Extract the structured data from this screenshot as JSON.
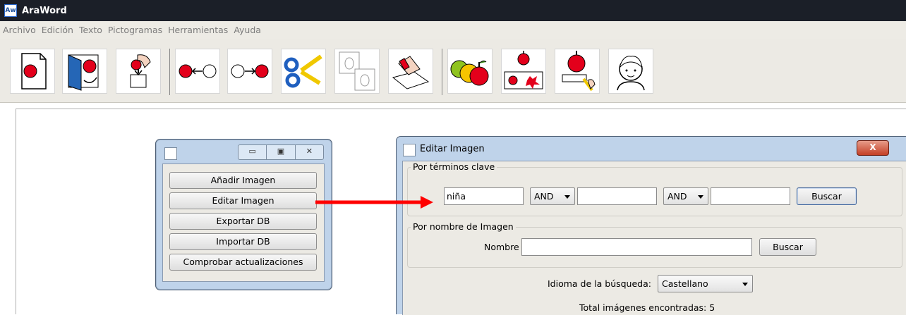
{
  "app": {
    "title": "AraWord",
    "icon_text": "Aw"
  },
  "menu": [
    "Archivo",
    "Edición",
    "Texto",
    "Pictogramas",
    "Herramientas",
    "Ayuda"
  ],
  "toolbar": {
    "icons": [
      "new-document-icon",
      "open-document-icon",
      "save-document-icon",
      "previous-icon",
      "next-icon",
      "scissors-icon",
      "copy-icon",
      "paste-icon",
      "pictogram-set-icon",
      "pictogram-variants-icon",
      "pictogram-edit-icon",
      "face-icon"
    ]
  },
  "mini_dialog": {
    "controls": [
      "▭",
      "▣",
      "✕"
    ],
    "buttons": [
      "Añadir Imagen",
      "Editar Imagen",
      "Exportar DB",
      "Importar DB",
      "Comprobar actualizaciones"
    ]
  },
  "edit_dialog": {
    "title": "Editar Imagen",
    "close_label": "X",
    "keywords_legend": "Por términos clave",
    "term1": "niña",
    "op1": "AND",
    "term2": "",
    "op2": "AND",
    "term3": "",
    "search_label": "Buscar",
    "name_legend": "Por nombre de Imagen",
    "name_label": "Nombre",
    "name_value": "",
    "name_search_label": "Buscar",
    "language_label": "Idioma de la búsqueda:",
    "language_value": "Castellano",
    "total_label": "Total imágenes encontradas: 5"
  },
  "colors": {
    "titlebar": "#1b1f28",
    "dialog_frame": "#bfd3ea",
    "arrow": "#ff0000",
    "close_button": "#c43f26"
  }
}
